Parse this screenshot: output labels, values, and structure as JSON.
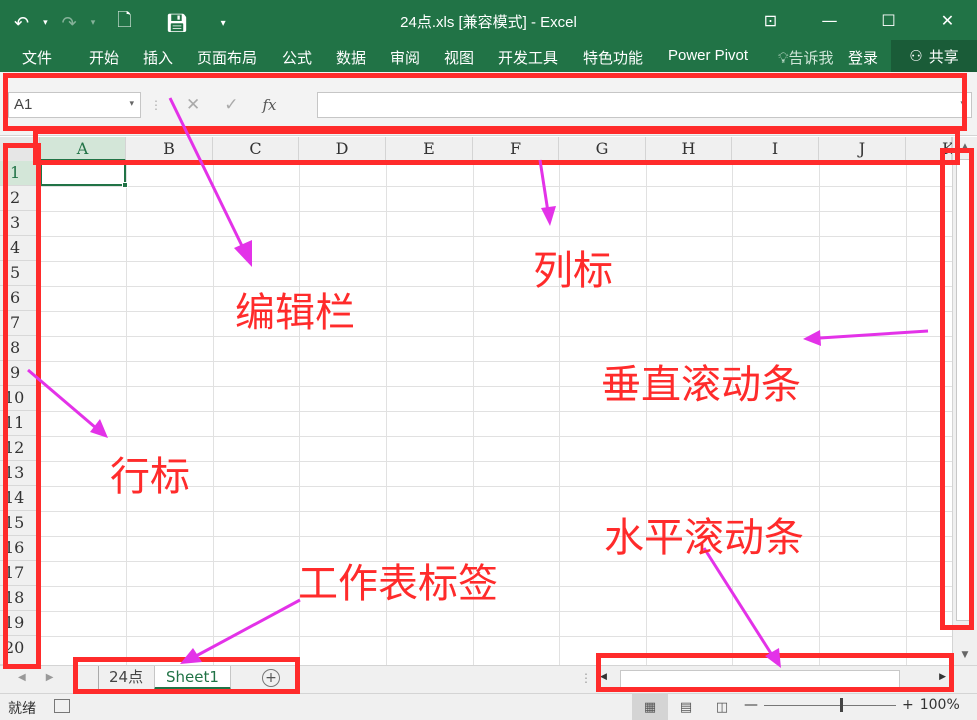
{
  "title": "24点.xls  [兼容模式] - Excel",
  "menu": [
    "文件",
    "开始",
    "插入",
    "页面布局",
    "公式",
    "数据",
    "审阅",
    "视图",
    "开发工具",
    "特色功能",
    "Power Pivot"
  ],
  "tell_me": "告诉我",
  "login": "登录",
  "share": "共享",
  "name_box": "A1",
  "columns": [
    "A",
    "B",
    "C",
    "D",
    "E",
    "F",
    "G",
    "H",
    "I",
    "J",
    "K"
  ],
  "rows": [
    "1",
    "2",
    "3",
    "4",
    "5",
    "6",
    "7",
    "8",
    "9",
    "10",
    "11",
    "12",
    "13",
    "14",
    "15",
    "16",
    "17",
    "18",
    "19",
    "20"
  ],
  "sheets": [
    "24点",
    "Sheet1"
  ],
  "status": "就绪",
  "zoom": "100%",
  "annotations": {
    "formula_bar": "编辑栏",
    "column_header": "列标",
    "row_header": "行标",
    "vscroll": "垂直滚动条",
    "hscroll": "水平滚动条",
    "sheet_tabs": "工作表标签"
  },
  "colors": {
    "excel_green": "#217346",
    "annotation_red": "#ff2b2b",
    "arrow_magenta": "#e332e8"
  }
}
